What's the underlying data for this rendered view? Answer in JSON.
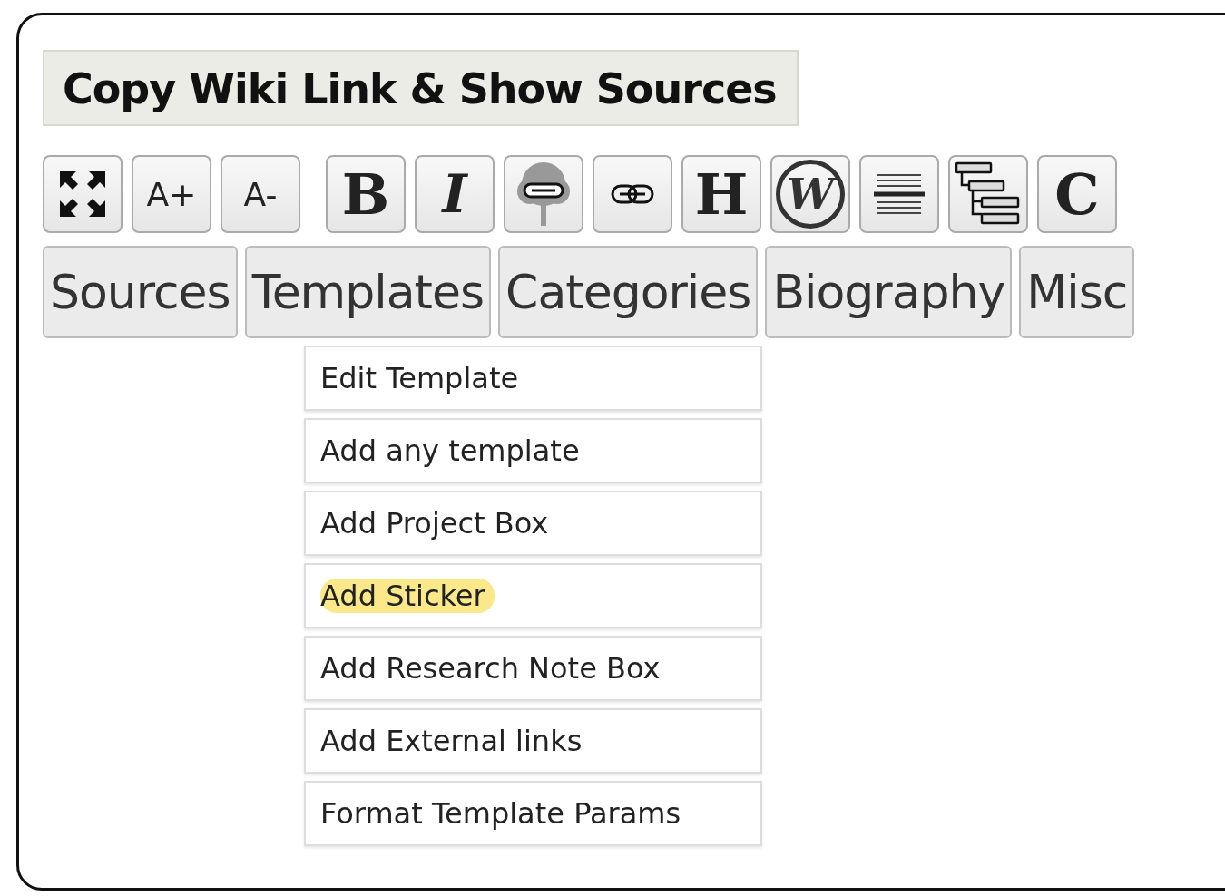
{
  "title": "Copy Wiki Link & Show Sources",
  "toolbar": [
    {
      "kind": "icon"
    },
    {
      "kind": "text",
      "label": "A+"
    },
    {
      "kind": "text",
      "label": "A-"
    },
    {
      "kind": "serif",
      "label": "B"
    },
    {
      "kind": "italic",
      "label": "I"
    },
    {
      "kind": "icon"
    },
    {
      "kind": "icon"
    },
    {
      "kind": "serif",
      "label": "H"
    },
    {
      "kind": "circled",
      "label": "W"
    },
    {
      "kind": "icon"
    },
    {
      "kind": "icon"
    },
    {
      "kind": "serif",
      "label": "C"
    }
  ],
  "tabs": [
    {
      "label": "Sources"
    },
    {
      "label": "Templates"
    },
    {
      "label": "Categories"
    },
    {
      "label": "Biography"
    },
    {
      "label": "Misc"
    }
  ],
  "menu": [
    {
      "label": "Edit Template",
      "highlighted": false
    },
    {
      "label": "Add any template",
      "highlighted": false
    },
    {
      "label": "Add Project Box",
      "highlighted": false
    },
    {
      "label": "Add Sticker",
      "highlighted": true
    },
    {
      "label": "Add Research Note Box",
      "highlighted": false
    },
    {
      "label": "Add External links",
      "highlighted": false
    },
    {
      "label": "Format Template Params",
      "highlighted": false
    }
  ]
}
